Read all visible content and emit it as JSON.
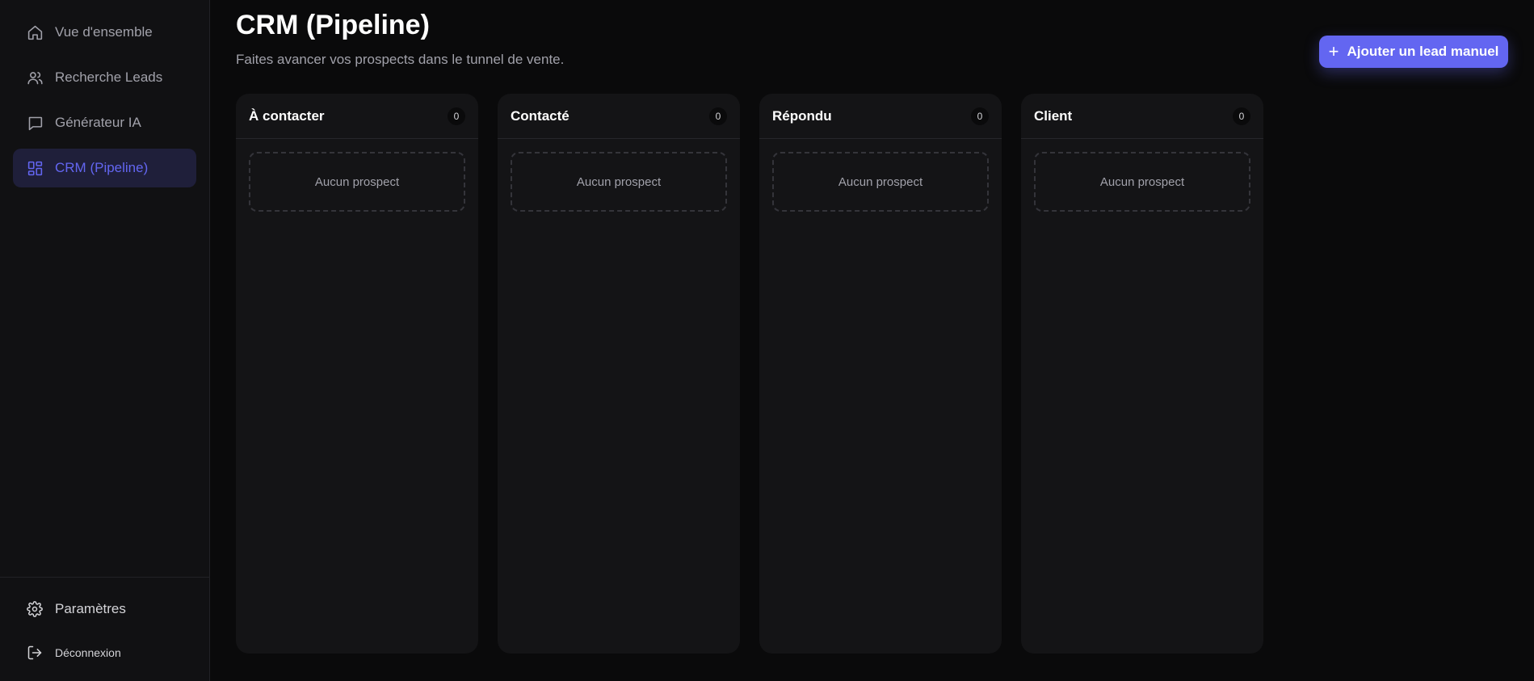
{
  "sidebar": {
    "items": [
      {
        "label": "Vue d'ensemble",
        "icon": "home-icon",
        "active": false
      },
      {
        "label": "Recherche Leads",
        "icon": "users-icon",
        "active": false
      },
      {
        "label": "Générateur IA",
        "icon": "message-square-icon",
        "active": true
      },
      {
        "label": "CRM (Pipeline)",
        "icon": "grid-icon",
        "active": true
      }
    ],
    "bottom": {
      "settings": "Paramètres",
      "logout": "Déconnexion"
    }
  },
  "header": {
    "title": "CRM (Pipeline)",
    "subtitle": "Faites avancer vos prospects dans le tunnel de vente.",
    "add_button": "Ajouter un lead manuel"
  },
  "board": {
    "columns": [
      {
        "title": "À contacter",
        "count": "0",
        "empty": "Aucun prospect"
      },
      {
        "title": "Contacté",
        "count": "0",
        "empty": "Aucun prospect"
      },
      {
        "title": "Répondu",
        "count": "0",
        "empty": "Aucun prospect"
      },
      {
        "title": "Client",
        "count": "0",
        "empty": "Aucun prospect"
      }
    ]
  },
  "colors": {
    "accent": "#6366f1",
    "background": "#0a0a0b",
    "sidebar": "#111113",
    "column": "#141416"
  }
}
